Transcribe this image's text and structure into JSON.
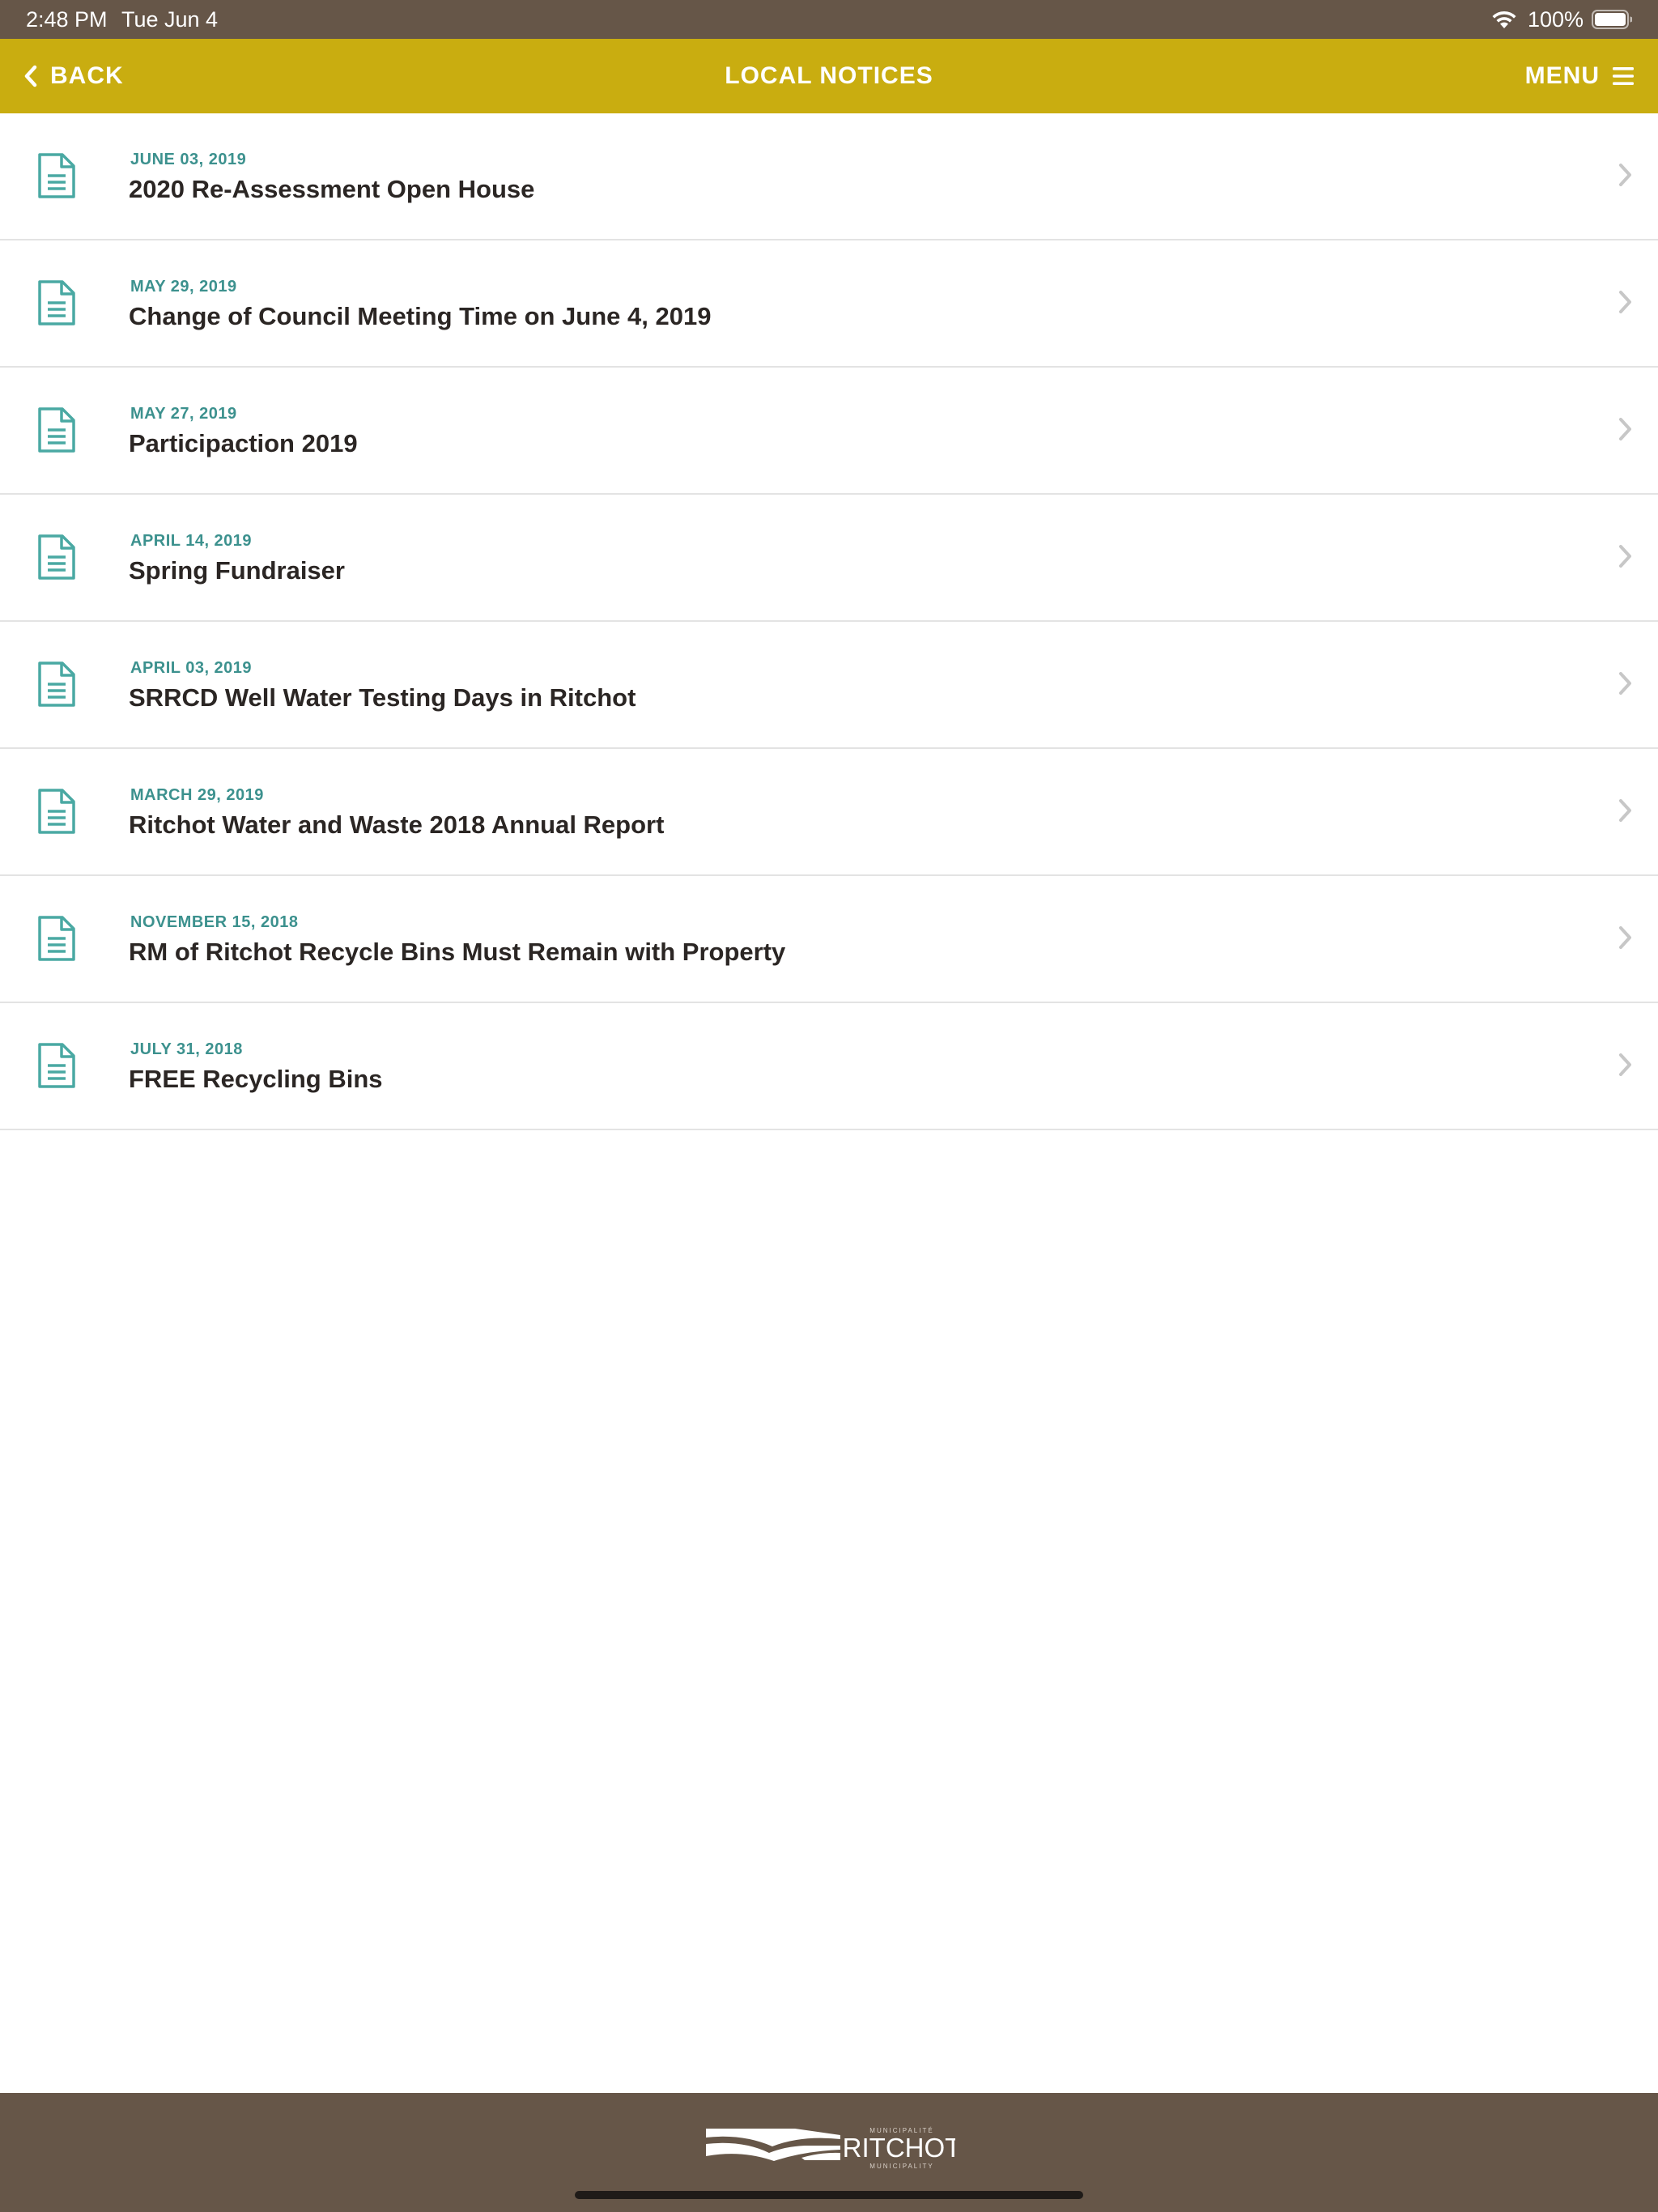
{
  "status_bar": {
    "time": "2:48 PM",
    "date": "Tue Jun 4",
    "battery_percent": "100%",
    "battery_level": 1.0
  },
  "nav": {
    "back_label": "BACK",
    "title": "LOCAL NOTICES",
    "menu_label": "MENU"
  },
  "notices": [
    {
      "date": "JUNE 03, 2019",
      "title": "2020 Re-Assessment Open House"
    },
    {
      "date": "MAY 29, 2019",
      "title": "Change of Council Meeting Time on June 4, 2019"
    },
    {
      "date": "MAY 27, 2019",
      "title": "Participaction 2019"
    },
    {
      "date": "APRIL 14, 2019",
      "title": "Spring Fundraiser"
    },
    {
      "date": "APRIL 03, 2019",
      "title": "SRRCD Well Water Testing Days in Ritchot"
    },
    {
      "date": "MARCH 29, 2019",
      "title": "Ritchot Water and Waste 2018 Annual Report"
    },
    {
      "date": "NOVEMBER 15, 2018",
      "title": "RM of Ritchot Recycle Bins Must Remain with Property"
    },
    {
      "date": "JULY 31, 2018",
      "title": "FREE Recycling Bins"
    }
  ],
  "footer": {
    "logo_top": "MUNICIPALITÉ",
    "logo_name": "RITCHOT",
    "logo_bottom": "MUNICIPALITY"
  },
  "icons": {
    "back": "chevron-left-icon",
    "menu": "hamburger-icon",
    "notice": "document-icon",
    "row_chevron": "chevron-right-icon"
  },
  "colors": {
    "status_bar": "#665648",
    "nav_bar": "#c9ad10",
    "date_accent": "#3c918e",
    "icon_accent": "#4aa9a3",
    "title_text": "#2b2624",
    "footer": "#665648"
  }
}
